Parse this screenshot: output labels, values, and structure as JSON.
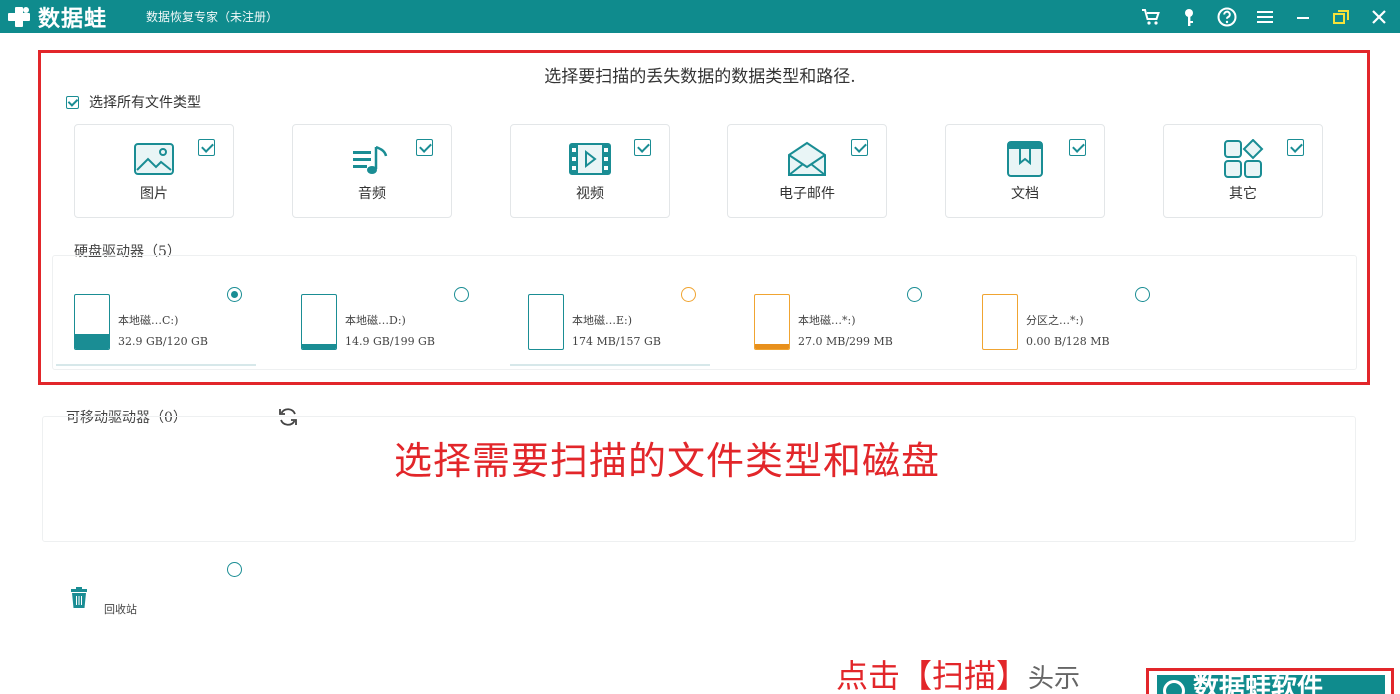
{
  "titlebar": {
    "app_name": "数据蛙",
    "subtitle": "数据恢复专家（未注册）"
  },
  "scan": {
    "heading": "选择要扫描的丢失数据的数据类型和路径.",
    "select_all_label": "选择所有文件类型",
    "file_types": [
      {
        "label": "图片",
        "checked": true,
        "icon": "image-icon"
      },
      {
        "label": "音频",
        "checked": true,
        "icon": "audio-icon"
      },
      {
        "label": "视频",
        "checked": true,
        "icon": "video-icon"
      },
      {
        "label": "电子邮件",
        "checked": true,
        "icon": "email-icon"
      },
      {
        "label": "文档",
        "checked": true,
        "icon": "document-icon"
      },
      {
        "label": "其它",
        "checked": true,
        "icon": "other-icon"
      }
    ]
  },
  "hdd": {
    "label": "硬盘驱动器（5）",
    "drives": [
      {
        "name": "本地磁…C:)",
        "size": "32.9 GB/120 GB",
        "selected": true,
        "fill": 0.27
      },
      {
        "name": "本地磁…D:)",
        "size": "14.9 GB/199 GB",
        "selected": false,
        "fill": 0.08
      },
      {
        "name": "本地磁…E:)",
        "size": "174 MB/157 GB",
        "selected": false,
        "fill": 0.0
      },
      {
        "name": "本地磁…*:)",
        "size": "27.0 MB/299 MB",
        "selected": false,
        "fill": 0.09
      },
      {
        "name": "分区之…*:)",
        "size": "0.00 B/128 MB",
        "selected": false,
        "fill": 0.0
      }
    ]
  },
  "removable": {
    "label": "可移动驱动器（0）"
  },
  "annotation": {
    "main": "选择需要扫描的文件类型和磁盘",
    "bottom": "点击【扫描】",
    "bottom_gray": "头示",
    "bottom_box": "数据蛙软件"
  },
  "trash": {
    "label": "回收站"
  },
  "colors": {
    "teal": "#0f8b8d",
    "annotation_red": "#e2262a",
    "drive_orange": "#e8901c"
  }
}
